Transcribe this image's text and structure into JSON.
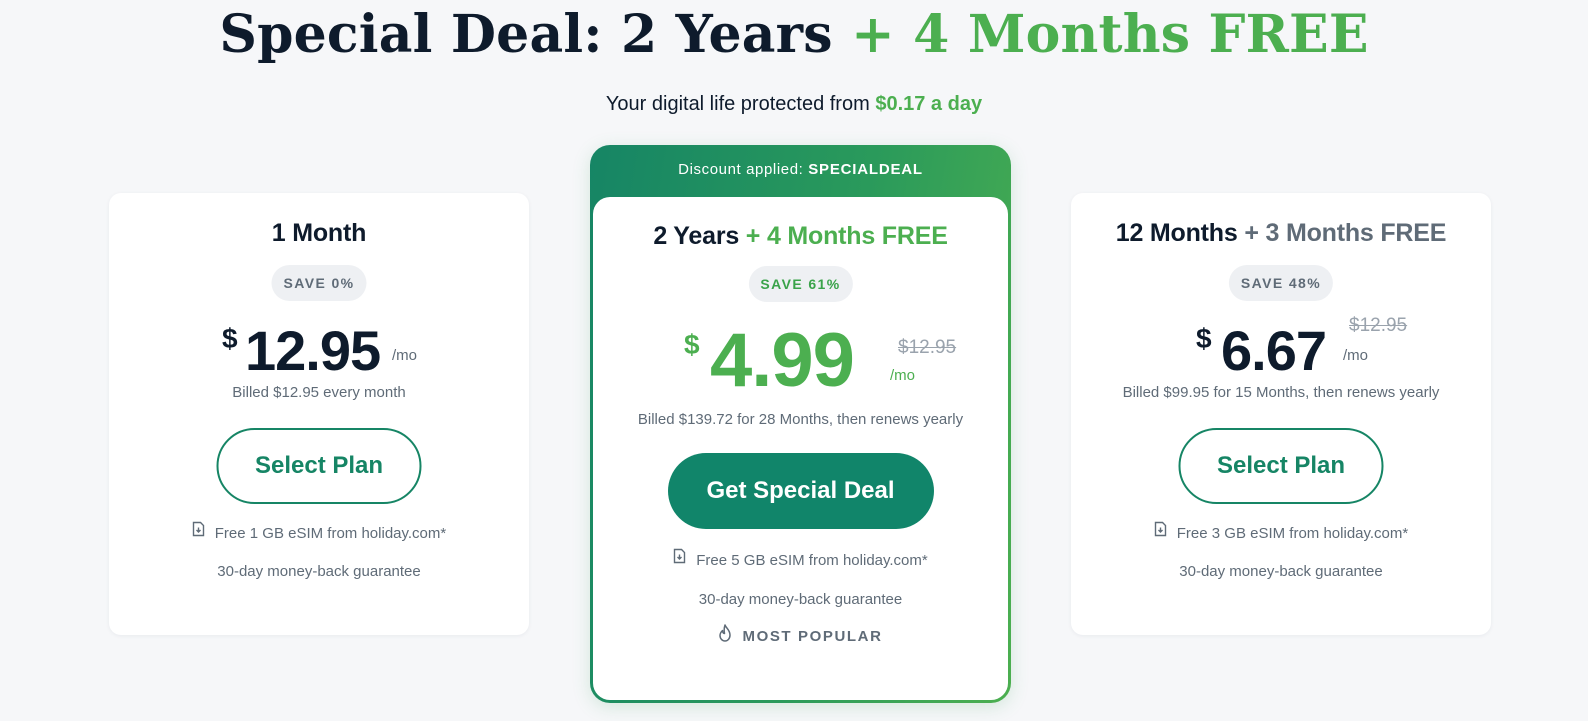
{
  "header": {
    "title_main": "Special Deal: 2 Years",
    "title_accent": "+ 4 Months FREE",
    "subtitle_prefix": "Your digital life protected from",
    "subtitle_accent": "$0.17 a day"
  },
  "colors": {
    "accent_green": "#4caf50",
    "brand_teal": "#168565",
    "text_dark": "#0e1b2c",
    "text_muted": "#5f6b77",
    "background": "#f6f7f9"
  },
  "plans": {
    "monthly": {
      "title": "1 Month",
      "save_badge": "SAVE 0%",
      "currency": "$",
      "price": "12.95",
      "per": "/mo",
      "billed": "Billed $12.95 every month",
      "cta": "Select Plan",
      "esim_icon": "esim-card-icon",
      "esim": "Free 1 GB eSIM from holiday.com*",
      "guarantee": "30-day money-back guarantee"
    },
    "special": {
      "banner_prefix": "Discount applied:",
      "banner_code": "SPECIALDEAL",
      "title_main": "2 Years",
      "title_accent": "+ 4 Months FREE",
      "save_badge": "SAVE 61%",
      "currency": "$",
      "price": "4.99",
      "old_price": "$12.95",
      "per": "/mo",
      "billed": "Billed $139.72 for 28 Months, then renews yearly",
      "cta": "Get Special Deal",
      "esim_icon": "esim-card-icon",
      "esim": "Free 5 GB eSIM from holiday.com*",
      "guarantee": "30-day money-back guarantee",
      "popular_icon": "fire-icon",
      "popular": "MOST POPULAR"
    },
    "yearly": {
      "title_main": "12 Months",
      "title_accent": "+ 3 Months FREE",
      "save_badge": "SAVE 48%",
      "currency": "$",
      "price": "6.67",
      "old_price": "$12.95",
      "per": "/mo",
      "billed": "Billed $99.95 for 15 Months, then renews yearly",
      "cta": "Select Plan",
      "esim_icon": "esim-card-icon",
      "esim": "Free 3 GB eSIM from holiday.com*",
      "guarantee": "30-day money-back guarantee"
    }
  }
}
